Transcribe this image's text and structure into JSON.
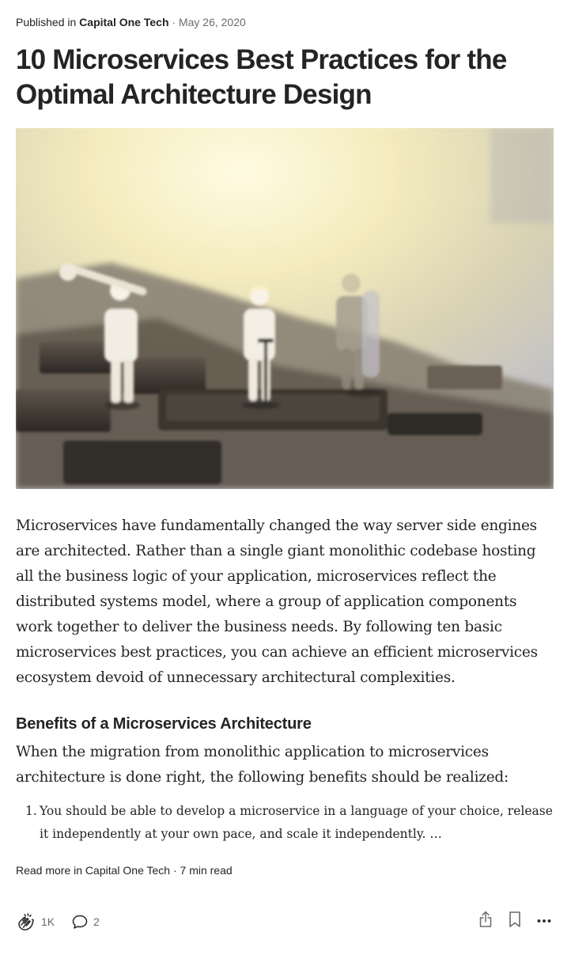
{
  "meta": {
    "published_prefix": "Published in",
    "publication": "Capital One Tech",
    "separator": "·",
    "date": "May 26, 2020"
  },
  "article": {
    "title": "10 Microservices Best Practices for the Optimal Architecture Design",
    "paragraph1": "Microservices have fundamentally changed the way server side engines are architected. Rather than a single giant monolithic codebase hosting all the business logic of your application, microservices reflect the distributed systems model, where a group of application components work together to deliver the business needs. By following ten basic microservices best practices, you can achieve an efficient microservices ecosystem devoid of unnecessary architectural complexities.",
    "subheading": "Benefits of a Microservices Architecture",
    "paragraph2": "When the migration from monolithic application to microservices architecture is done right, the following benefits should be realized:",
    "list": [
      {
        "number": "1.",
        "text": "You should be able to develop a microservice in a language of your choice, release it independently at your own pace, and scale it independently. …"
      }
    ]
  },
  "footer": {
    "read_more": "Read more in Capital One Tech · 7 min read",
    "claps": "1K",
    "comments": "2"
  },
  "icons": {
    "clap": "clap-icon",
    "comment": "comment-icon",
    "share": "share-icon",
    "bookmark": "bookmark-icon",
    "more": "more-icon"
  },
  "colors": {
    "text": "#242424",
    "muted": "#6b6b6b"
  }
}
